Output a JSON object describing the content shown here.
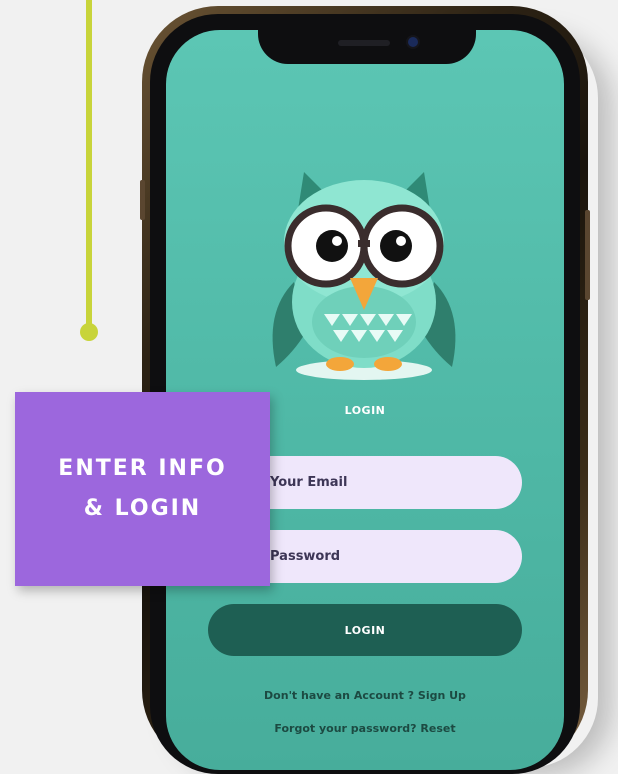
{
  "screen": {
    "login_heading": "LOGIN",
    "email_placeholder": "Your Email",
    "password_placeholder": "Password",
    "login_button_label": "LOGIN",
    "signup_prompt": "Don't have an Account ? Sign Up",
    "forgot_prompt": "Forgot your password? Reset"
  },
  "callout": {
    "line1": "ENTER INFO",
    "line2": "& LOGIN"
  },
  "colors": {
    "screen_teal": "#4fb8a6",
    "button_dark_green": "#1e5f53",
    "input_lavender": "#efe7fb",
    "callout_purple": "#9c67dd",
    "callout_line_lime": "#c8d43a"
  },
  "icons": {
    "mascot": "owl-mascot"
  }
}
